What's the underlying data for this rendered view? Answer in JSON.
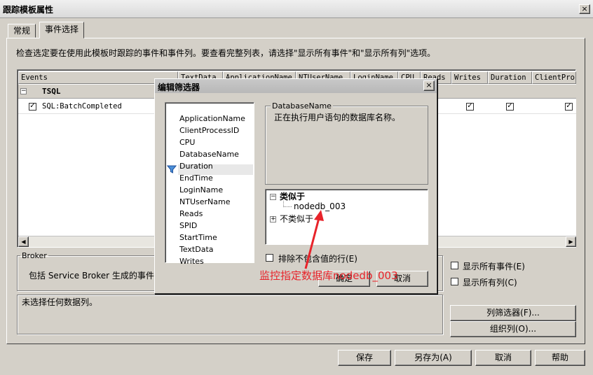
{
  "window": {
    "title": "跟踪模板属性",
    "close": "×"
  },
  "tabs": [
    {
      "label": "常规"
    },
    {
      "label": "事件选择"
    }
  ],
  "instructions": "检查选定要在使用此模板时跟踪的事件和事件列。要查看完整列表，请选择\"显示所有事件\"和\"显示所有列\"选项。",
  "grid": {
    "headers": [
      "Events",
      "TextData",
      "ApplicationName",
      "NTUserName",
      "LoginName",
      "CPU",
      "Reads",
      "Writes",
      "Duration",
      "ClientProcessID"
    ],
    "category": {
      "toggle": "−",
      "name": "TSQL"
    },
    "event": {
      "name": "SQL:BatchCompleted",
      "checked": "✓"
    }
  },
  "broker": {
    "legend": "Broker",
    "description": "包括 Service Broker 生成的事件类。"
  },
  "no_column": "未选择任何数据列。",
  "options": {
    "show_all_events": "显示所有事件(E)",
    "show_all_columns": "显示所有列(C)"
  },
  "side_buttons": {
    "column_filter": "列筛选器(F)...",
    "organize": "组织列(O)..."
  },
  "bottom_buttons": {
    "save": "保存",
    "save_as": "另存为(A)",
    "cancel": "取消",
    "help": "帮助"
  },
  "dialog": {
    "title": "编辑筛选器",
    "close": "×",
    "columns": [
      "ApplicationName",
      "ClientProcessID",
      "CPU",
      "DatabaseName",
      "Duration",
      "EndTime",
      "LoginName",
      "NTUserName",
      "Reads",
      "SPID",
      "StartTime",
      "TextData",
      "Writes"
    ],
    "selected_column": "DatabaseName",
    "desc_legend": "DatabaseName",
    "desc_text": "正在执行用户语句的数据库名称。",
    "tree": {
      "like": "类似于",
      "like_value": "nodedb_003",
      "not_like": "不类似于"
    },
    "exclude_nulls": "排除不包含值的行(E)",
    "ok": "确定",
    "cancel": "取消"
  },
  "annotation": "监控指定数据库nodedb_003",
  "colors": {
    "annotation": "#e8232a",
    "window_bg": "#d4d0c8"
  }
}
